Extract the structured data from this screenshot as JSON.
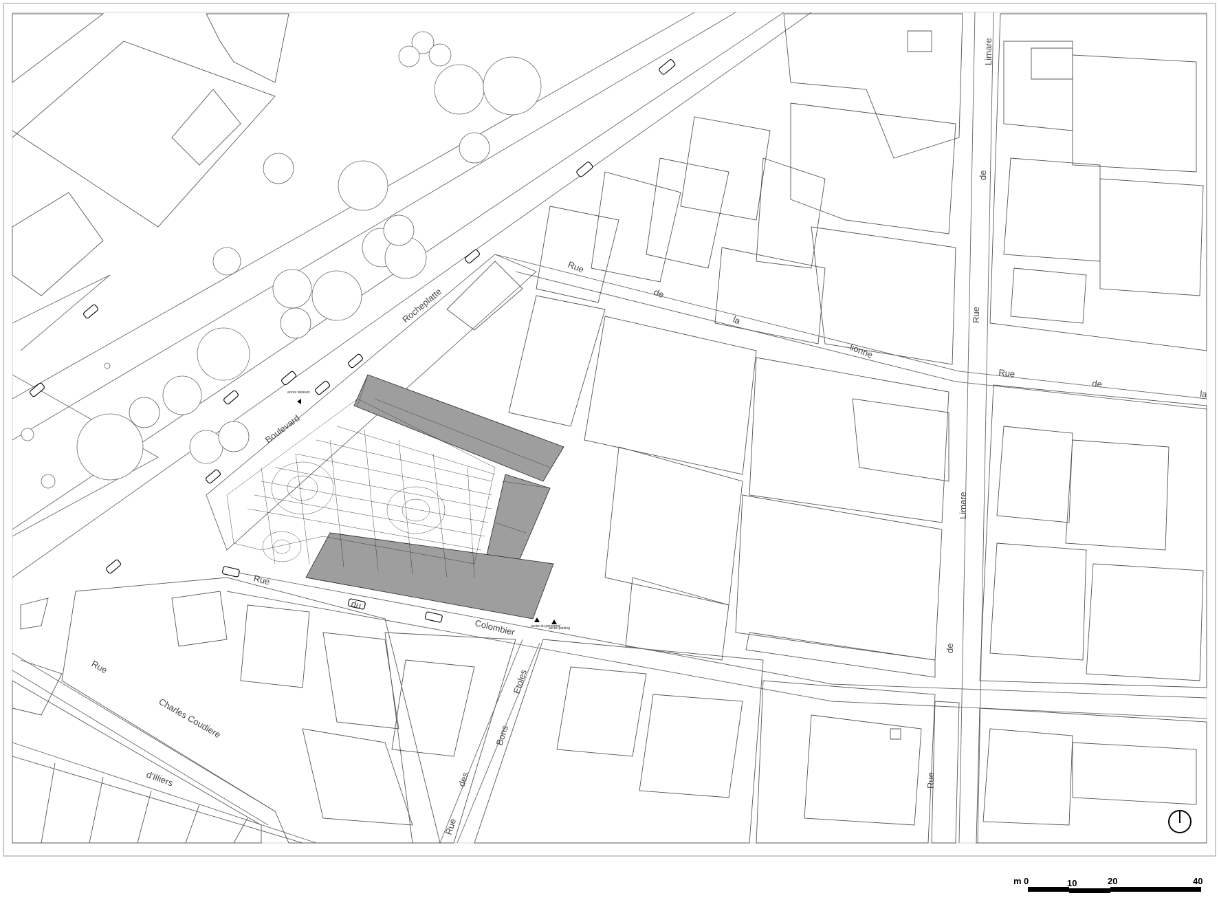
{
  "streets": {
    "boulevard": "Boulevard",
    "rocheplatte": "Rocheplatte",
    "rue_colombier_1": "Rue",
    "rue_colombier_2": "du",
    "rue_colombier_3": "Colombier",
    "rue_lionne_1": "Rue",
    "rue_lionne_2": "de",
    "rue_lionne_3": "la",
    "rue_lionne_4": "lionne",
    "rue_limare_top_1": "Limare",
    "rue_limare_top_2": "de",
    "rue_limare_top_3": "Rue",
    "rue_limare_mid_1": "Limare",
    "rue_limare_mid_2": "de",
    "rue_limare_bottom": "Rue",
    "rue_de_right_1": "Rue",
    "rue_de_right_2": "de",
    "rue_de_right_3": "la",
    "rue_charles_1": "Rue",
    "rue_charles_2": "Charles Coudiere",
    "rue_charles_3": "d'Illiers",
    "rue_bons_1": "Rue",
    "rue_bons_2": "des",
    "rue_bons_3": "Bons",
    "rue_bons_4": "Etoles"
  },
  "access_labels": {
    "personnel": "accès du personnel",
    "parking": "accès parking",
    "visiteurs": "accès visiteurs"
  },
  "scale_bar": {
    "unit": "m",
    "ticks": [
      "0",
      "10",
      "20",
      "40"
    ]
  },
  "north_icon": "north-arrow-icon",
  "colors": {
    "roof": "#9e9e9e",
    "lines": "#555555",
    "background": "#ffffff"
  }
}
